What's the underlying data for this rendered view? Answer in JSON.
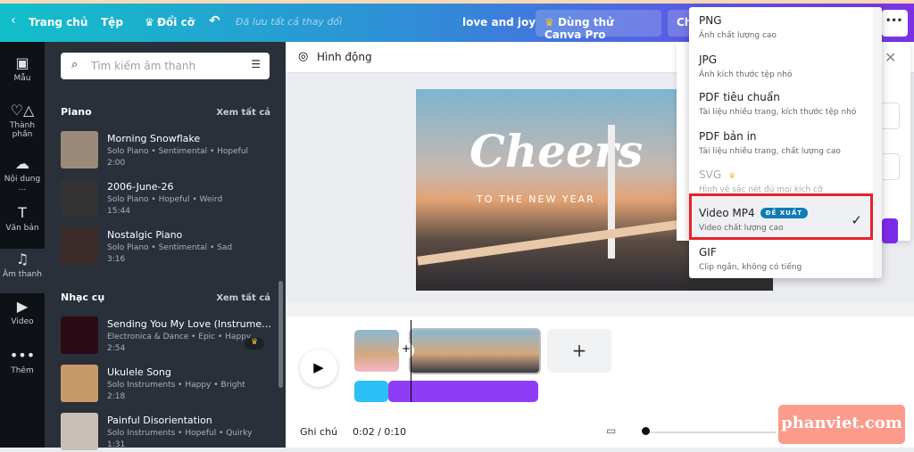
{
  "topbar": {
    "back": "Trang chủ",
    "file": "Tệp",
    "resize": "Đổi cỡ",
    "saved": "Đã lưu tất cả thay đổi",
    "title": "love and joy",
    "pro": "Dùng thử Canva Pro",
    "share_partial": "Ch",
    "more": "•••"
  },
  "rail": [
    {
      "label": "Mẫu",
      "icon": "▣"
    },
    {
      "label": "Thành phần",
      "icon": "♡△"
    },
    {
      "label": "Nội dung ...",
      "icon": "☁"
    },
    {
      "label": "Văn bản",
      "icon": "T"
    },
    {
      "label": "Âm thanh",
      "icon": "♫"
    },
    {
      "label": "Video",
      "icon": "▶"
    },
    {
      "label": "Thêm",
      "icon": "•••"
    }
  ],
  "panel": {
    "search_placeholder": "Tìm kiếm âm thanh",
    "sections": [
      {
        "title": "Piano",
        "see_all": "Xem tất cả",
        "tracks": [
          {
            "title": "Morning Snowflake",
            "tags": "Solo Piano • Sentimental • Hopeful",
            "duration": "2:00",
            "color": "#9a8a7a"
          },
          {
            "title": "2006-June-26",
            "tags": "Solo Piano • Hopeful • Weird",
            "duration": "15:44",
            "color": "#333"
          },
          {
            "title": "Nostalgic Piano",
            "tags": "Solo Piano • Sentimental • Sad",
            "duration": "3:16",
            "color": "#3a2a28"
          }
        ]
      },
      {
        "title": "Nhạc cụ",
        "see_all": "Xem tất cả",
        "tracks": [
          {
            "title": "Sending You My Love (Instrumental)",
            "tags": "Electronica & Dance • Epic • Happy",
            "duration": "2:54",
            "color": "#2a0a14",
            "pro": true
          },
          {
            "title": "Ukulele Song",
            "tags": "Solo Instruments • Happy • Bright",
            "duration": "2:18",
            "color": "#c89a6a"
          },
          {
            "title": "Painful Disorientation",
            "tags": "Solo Instruments • Hopeful • Quirky",
            "duration": "1:31",
            "color": "#c8c0b8"
          }
        ]
      }
    ]
  },
  "toolbar": {
    "animate": "Hình động"
  },
  "design": {
    "script": "Cheers",
    "sub": "TO THE NEW YEAR"
  },
  "timeline": {
    "notes": "Ghi chú",
    "time": "0:02 / 0:10"
  },
  "download_menu": {
    "options": [
      {
        "name": "PNG",
        "desc": "Ảnh chất lượng cao"
      },
      {
        "name": "JPG",
        "desc": "Ảnh kích thước tệp nhỏ"
      },
      {
        "name": "PDF tiêu chuẩn",
        "desc": "Tài liệu nhiều trang, kích thước tệp nhỏ"
      },
      {
        "name": "PDF bản in",
        "desc": "Tài liệu nhiều trang, chất lượng cao"
      },
      {
        "name": "SVG",
        "desc": "Hình vẽ sắc nét đủ mọi kích cỡ",
        "pro": true,
        "disabled": true
      },
      {
        "name": "Video MP4",
        "desc": "Video chất lượng cao",
        "badge": "ĐỀ XUẤT",
        "selected": true
      },
      {
        "name": "GIF",
        "desc": "Clip ngắn, không có tiếng"
      }
    ]
  },
  "watermark": "phanviet.com",
  "colors": {
    "highlight": "#e8202a",
    "accent": "#7d2ae8",
    "audio_blue": "#2bc0f5",
    "audio_purple": "#8f3cf5"
  }
}
